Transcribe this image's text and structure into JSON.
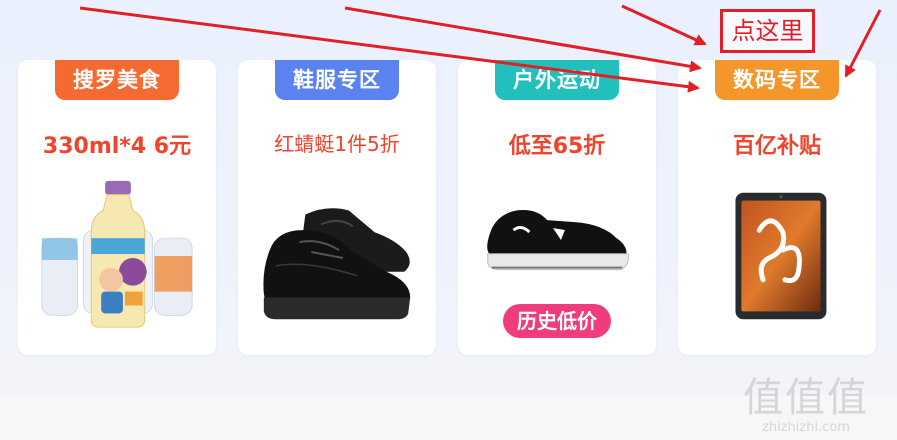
{
  "cards": [
    {
      "tag": "搜罗美食",
      "tag_color": "#f46a30",
      "subtitle": "330ml*4  6元",
      "product_icon": "milk-drink-bottles"
    },
    {
      "tag": "鞋服专区",
      "tag_color": "#5a83ef",
      "subtitle": "红蜻蜓1件5折",
      "product_icon": "leather-shoe"
    },
    {
      "tag": "户外运动",
      "tag_color": "#22c0bd",
      "subtitle": "低至65折",
      "product_icon": "sports-sneaker",
      "pill": "历史低价",
      "pill_color": "#ef3d7b"
    },
    {
      "tag": "数码专区",
      "tag_color": "#f4962a",
      "subtitle": "百亿补贴",
      "product_icon": "tablet"
    }
  ],
  "annotation": {
    "text": "点这里",
    "color": "#e21f26"
  },
  "watermark": {
    "glyphs": "值值值",
    "url": "zhizhizhi.com"
  }
}
